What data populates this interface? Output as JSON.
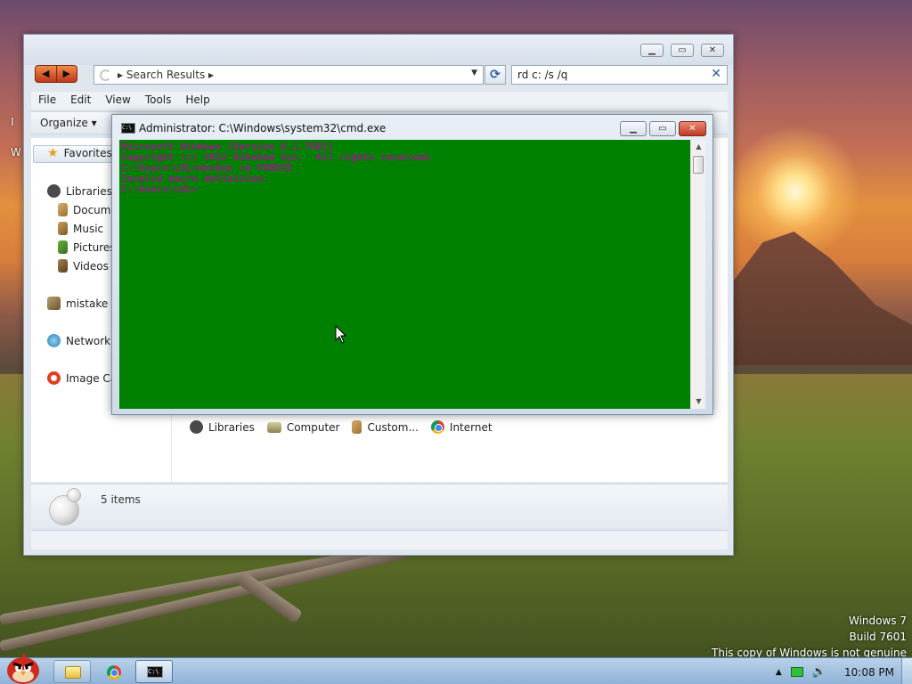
{
  "desktop": {
    "watermark": [
      "Windows 7",
      "Build 7601",
      "This copy of Windows is not genuine"
    ],
    "fragment_left": "W",
    "fragment_mid": "I"
  },
  "explorer": {
    "address_crumb": "Search Results",
    "search_value": "rd c: /s /q",
    "menu": [
      "File",
      "Edit",
      "View",
      "Tools",
      "Help"
    ],
    "organize_label": "Organize",
    "nav": {
      "favorites": "Favorites",
      "libraries": "Libraries",
      "documents": "Docume",
      "music": "Music",
      "pictures": "Pictures",
      "videos": "Videos",
      "homegroup": "mistake",
      "network": "Network",
      "imagecat": "Image Cat"
    },
    "results": [
      "Libraries",
      "Computer",
      "Custom...",
      "Internet"
    ],
    "status_items": "5 items"
  },
  "cmd": {
    "title": "Administrator: C:\\Windows\\system32\\cmd.exe",
    "lines": [
      "Microsoft Windows [Version 6.1.7601]",
      "Copyright (c) 2012 Dikohad Sys.  All rights reserved.",
      "",
      "C:\\Users\\LOL>doskey rd FORKIE",
      "Invalid macro definition.",
      "",
      "C:\\Users\\LOL>"
    ]
  },
  "taskbar": {
    "clock": "10:08 PM"
  },
  "icons": {
    "start": "angry-bird-orb",
    "explorer_btn": "folder-icon",
    "chrome_btn": "chrome-icon",
    "cmd_btn": "cmd-icon"
  }
}
